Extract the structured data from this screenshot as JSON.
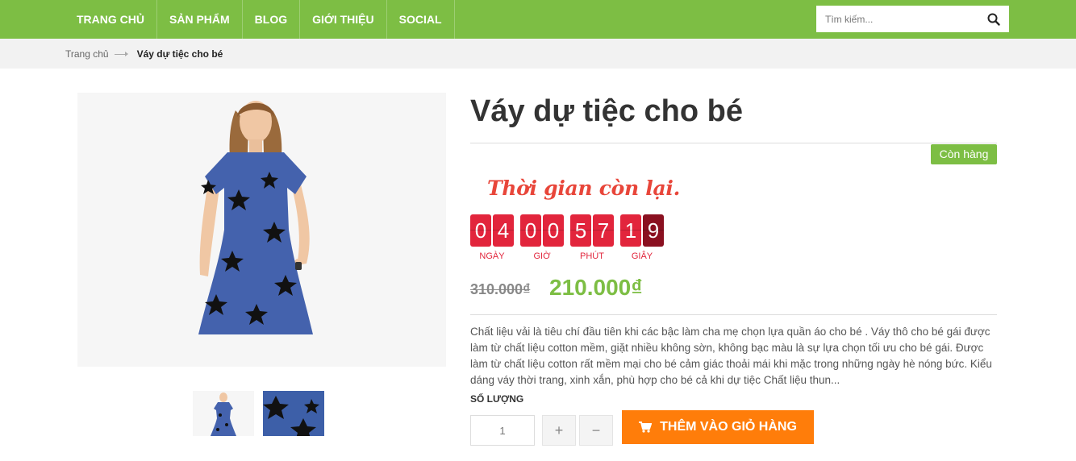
{
  "nav": {
    "items": [
      "TRANG CHỦ",
      "SẢN PHẨM",
      "BLOG",
      "GIỚI THIỆU",
      "SOCIAL"
    ],
    "search_placeholder": "Tìm kiếm..."
  },
  "breadcrumb": {
    "home": "Trang chủ",
    "current": "Váy dự tiệc cho bé"
  },
  "product": {
    "title": "Váy dự tiệc cho bé",
    "stock": "Còn hàng",
    "countdown": {
      "title": "Thời gian còn lại.",
      "digits": [
        "0",
        "4",
        "0",
        "0",
        "5",
        "7",
        "1",
        "9"
      ],
      "labels": [
        "NGÀY",
        "GIỜ",
        "PHÚT",
        "GIÂY"
      ]
    },
    "price_old": "310.000₫",
    "price_new": "210.000₫",
    "description": "Chất liệu vải là tiêu chí đầu tiên khi các bậc làm cha mẹ chọn lựa quần áo cho bé . Váy thô cho bé gái được làm từ chất liệu cotton mềm, giặt nhiều không sờn, không bạc màu là sự lựa chọn tối ưu cho bé gái. Được làm từ chất liệu cotton rất mềm mại cho bé cảm giác thoải mái khi mặc trong những ngày hè nóng bức. Kiểu dáng váy thời trang, xinh xắn, phù hợp cho bé cả khi dự tiệc Chất liệu thun...",
    "quantity_label": "SỐ LƯỢNG",
    "quantity_value": "1",
    "plus": "+",
    "minus": "−",
    "add_to_cart": "THÊM VÀO GIỎ HÀNG"
  },
  "icons": {
    "search": "search-icon",
    "cart": "cart-icon"
  },
  "colors": {
    "brand_green": "#7dbe44",
    "countdown_red": "#e2253c",
    "cart_orange": "#ff7d0a"
  }
}
